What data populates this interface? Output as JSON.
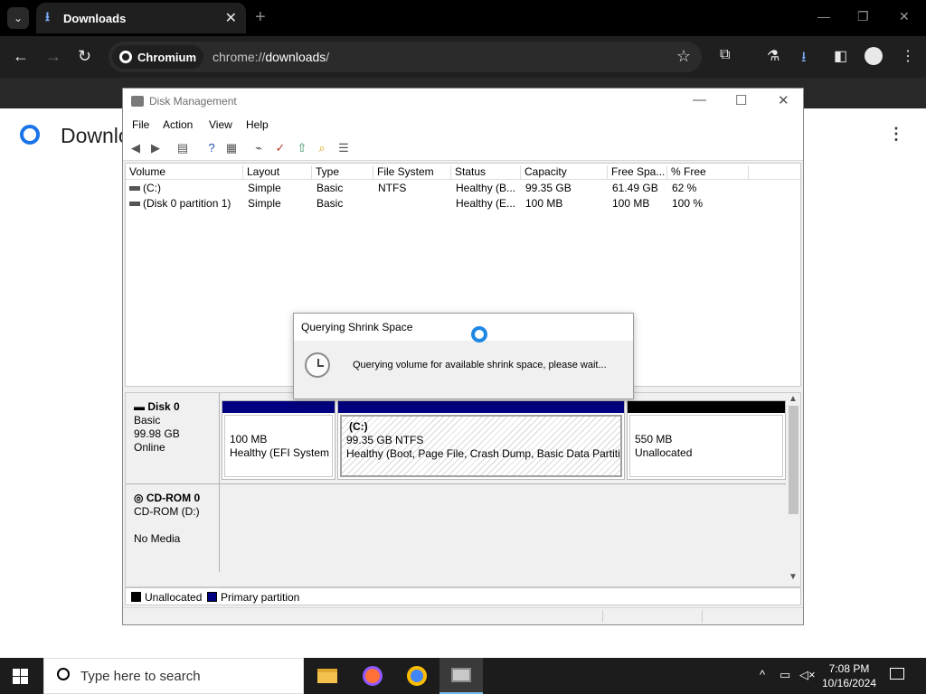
{
  "browser": {
    "tab_title": "Downloads",
    "tab_close": "✕",
    "new_tab": "+",
    "chip_label": "Chromium",
    "url_scheme": "chrome://",
    "url_host": "downloads",
    "url_tail": "/",
    "window_min": "—",
    "window_restore": "❐",
    "window_close": "✕"
  },
  "page": {
    "title": "Downloads"
  },
  "disk_mgmt": {
    "title": "Disk Management",
    "menu": [
      "File",
      "Action",
      "View",
      "Help"
    ],
    "columns": [
      "Volume",
      "Layout",
      "Type",
      "File System",
      "Status",
      "Capacity",
      "Free Spa...",
      "% Free"
    ],
    "volumes": [
      [
        "(C:)",
        "Simple",
        "Basic",
        "NTFS",
        "Healthy (B...",
        "99.35 GB",
        "61.49 GB",
        "62 %"
      ],
      [
        "(Disk 0 partition 1)",
        "Simple",
        "Basic",
        "",
        "Healthy (E...",
        "100 MB",
        "100 MB",
        "100 %"
      ]
    ],
    "disk0": {
      "name": "Disk 0",
      "type": "Basic",
      "size": "99.98 GB",
      "state": "Online",
      "partitions": [
        {
          "name": "",
          "size": "100 MB",
          "desc": "Healthy (EFI System P",
          "kind": "primary"
        },
        {
          "name": "(C:)",
          "size": "99.35 GB NTFS",
          "desc": "Healthy (Boot, Page File, Crash Dump, Basic Data Partition",
          "kind": "primary"
        },
        {
          "name": "",
          "size": "550 MB",
          "desc": "Unallocated",
          "kind": "unallocated"
        }
      ]
    },
    "cdrom": {
      "name": "CD-ROM 0",
      "type": "CD-ROM (D:)",
      "media": "No Media"
    },
    "legend": {
      "unallocated": "Unallocated",
      "primary": "Primary partition"
    },
    "colors": {
      "primary": "#000080",
      "unallocated": "#000000"
    }
  },
  "dialog": {
    "title": "Querying Shrink Space",
    "message": "Querying volume for available shrink space, please wait..."
  },
  "taskbar": {
    "search_placeholder": "Type here to search",
    "time": "7:08 PM",
    "date": "10/16/2024"
  }
}
